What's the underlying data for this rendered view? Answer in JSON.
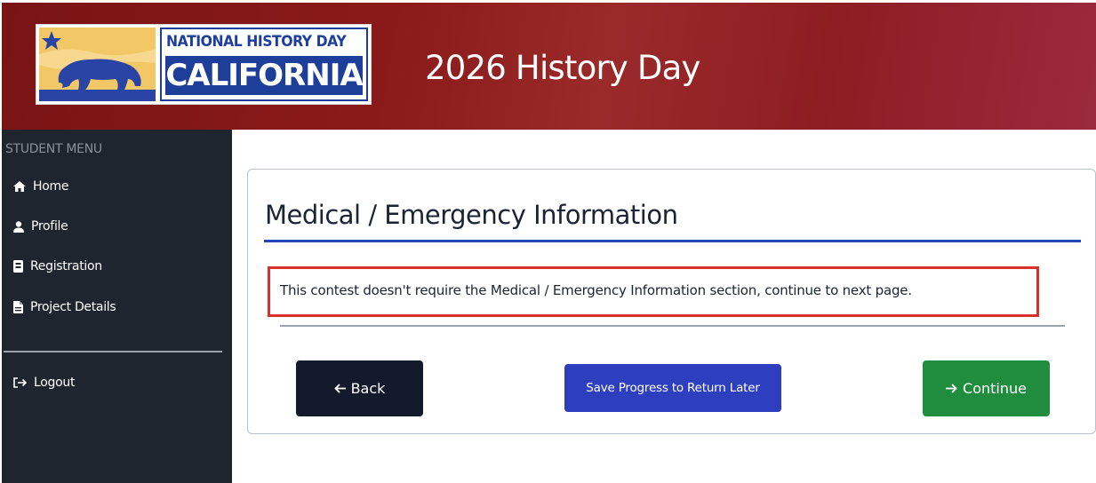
{
  "header": {
    "logo": {
      "line1": "NATIONAL HISTORY DAY",
      "line2": "CALIFORNIA"
    },
    "title": "2026 History Day"
  },
  "sidebar": {
    "heading": "STUDENT MENU",
    "items": [
      {
        "label": "Home",
        "icon": "home-icon"
      },
      {
        "label": "Profile",
        "icon": "user-icon"
      },
      {
        "label": "Registration",
        "icon": "badge-icon"
      },
      {
        "label": "Project Details",
        "icon": "file-icon"
      }
    ],
    "logout": {
      "label": "Logout",
      "icon": "logout-icon"
    }
  },
  "main": {
    "title": "Medical / Emergency Information",
    "notice": "This contest doesn't require the Medical / Emergency Information section, continue to next page.",
    "buttons": {
      "back": "Back",
      "save": "Save Progress to Return Later",
      "continue": "Continue"
    }
  },
  "colors": {
    "header_red": "#8a1a1a",
    "sidebar_bg": "#1f252e",
    "accent_blue": "#2545b8",
    "notice_border": "#d9302b",
    "back_button": "#131a2b",
    "save_button": "#2d3fbf",
    "continue_button": "#1f8c3e"
  }
}
